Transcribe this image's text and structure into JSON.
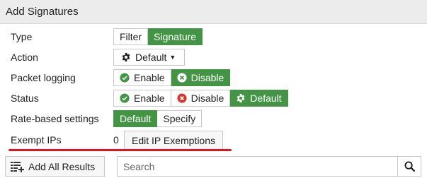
{
  "header": {
    "title": "Add Signatures"
  },
  "fields": {
    "type": {
      "label": "Type",
      "options": [
        "Filter",
        "Signature"
      ],
      "selected": "Signature"
    },
    "action": {
      "label": "Action",
      "value": "Default"
    },
    "packet_logging": {
      "label": "Packet logging",
      "options": [
        "Enable",
        "Disable"
      ],
      "selected": "Disable"
    },
    "status": {
      "label": "Status",
      "options": [
        "Enable",
        "Disable",
        "Default"
      ],
      "selected": "Default"
    },
    "rate_based": {
      "label": "Rate-based settings",
      "options": [
        "Default",
        "Specify"
      ],
      "selected": "Default"
    },
    "exempt_ips": {
      "label": "Exempt IPs",
      "count": "0",
      "button_label": "Edit IP Exemptions"
    }
  },
  "toolbar": {
    "add_all_label": "Add All Results",
    "search_placeholder": "Search"
  },
  "colors": {
    "accent_green": "#449446",
    "annotation_red": "#e0141e"
  },
  "icons": [
    "gear-icon",
    "caret-down-icon",
    "check-circle-icon",
    "x-circle-icon",
    "x-circle-red-icon",
    "add-list-icon",
    "search-icon"
  ]
}
